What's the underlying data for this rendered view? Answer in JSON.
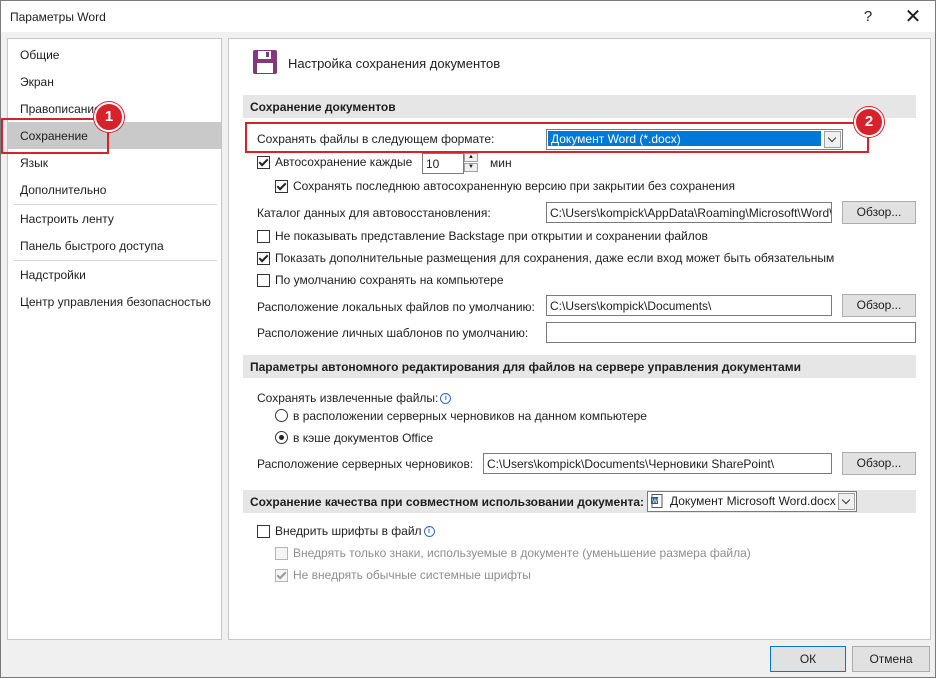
{
  "window": {
    "title": "Параметры Word",
    "help": "?",
    "close": "✕"
  },
  "nav": {
    "items": [
      "Общие",
      "Экран",
      "Правописание",
      "Сохранение",
      "Язык",
      "Дополнительно",
      "Настроить ленту",
      "Панель быстрого доступа",
      "Надстройки",
      "Центр управления безопасностью"
    ],
    "selected_index": 3
  },
  "header": {
    "title": "Настройка сохранения документов",
    "icon": "save-icon"
  },
  "save_docs": {
    "section_title": "Сохранение документов",
    "format_label": "Сохранять файлы в следующем формате:",
    "format_value": "Документ Word (*.docx)",
    "autosave_label": "Автосохранение каждые",
    "autosave_value": "10",
    "autosave_unit": "мин",
    "keep_last_label": "Сохранять последнюю автосохраненную версию при закрытии без сохранения",
    "autorecover_label": "Каталог данных для автовосстановления:",
    "autorecover_path": "C:\\Users\\kompick\\AppData\\Roaming\\Microsoft\\Word\\",
    "browse": "Обзор...",
    "no_backstage_label": "Не показывать представление Backstage при открытии и сохранении файлов",
    "show_extra_label": "Показать дополнительные размещения для сохранения, даже если вход может быть обязательным",
    "default_local_label": "По умолчанию сохранять на компьютере",
    "local_files_label": "Расположение локальных файлов по умолчанию:",
    "local_files_path": "C:\\Users\\kompick\\Documents\\",
    "templates_label": "Расположение личных шаблонов по умолчанию:",
    "templates_path": ""
  },
  "offline": {
    "section_title": "Параметры автономного редактирования для файлов на сервере управления документами",
    "extracted_label": "Сохранять извлеченные файлы:",
    "radio1": "в расположении серверных черновиков на данном компьютере",
    "radio2": "в кэше документов Office",
    "drafts_label": "Расположение серверных черновиков:",
    "drafts_path": "C:\\Users\\kompick\\Documents\\Черновики SharePoint\\",
    "browse": "Обзор..."
  },
  "quality": {
    "section_title": "Сохранение качества при совместном использовании документа:",
    "doc_value": "Документ Microsoft Word.docx",
    "embed_label": "Внедрить шрифты в файл",
    "embed_only_used_label": "Внедрять только знаки, используемые в документе (уменьшение размера файла)",
    "no_common_label": "Не внедрять обычные системные шрифты"
  },
  "footer": {
    "ok": "ОК",
    "cancel": "Отмена"
  },
  "callouts": {
    "one": "1",
    "two": "2"
  },
  "colors": {
    "accent_red": "#d8222b",
    "selection_blue": "#0078d7",
    "icon_purple": "#80397b"
  },
  "state": {
    "autosave_checked": true,
    "keep_last_checked": true,
    "no_backstage_checked": false,
    "show_extra_checked": true,
    "default_local_checked": false,
    "offline_radio": 2,
    "embed_checked": false,
    "embed_only_used_checked": false,
    "no_common_checked": true
  }
}
